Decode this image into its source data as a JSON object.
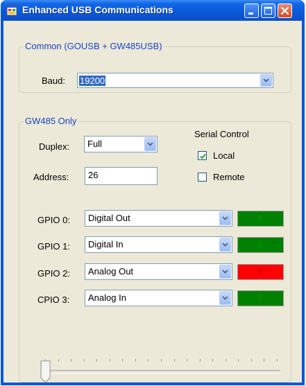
{
  "window": {
    "title": "Enhanced USB Communications",
    "controls": {
      "minimize_icon": "minimize-icon",
      "maximize_icon": "maximize-icon",
      "close_icon": "close-icon"
    }
  },
  "common": {
    "title": "Common (GOUSB + GW485USB)",
    "baud_label": "Baud:",
    "baud_value": "19200"
  },
  "gw485": {
    "title": "GW485 Only",
    "duplex_label": "Duplex:",
    "duplex_value": "Full",
    "address_label": "Address:",
    "address_value": "26",
    "serial_control_label": "Serial Control",
    "local_label": "Local",
    "local_checked": true,
    "remote_label": "Remote",
    "remote_checked": false,
    "gpio": [
      {
        "label": "GPIO 0:",
        "mode": "Digital Out",
        "value": "0",
        "color": "#008000"
      },
      {
        "label": "GPIO 1:",
        "mode": "Digital In",
        "value": "0",
        "color": "#008000"
      },
      {
        "label": "GPIO 2:",
        "mode": "Analog Out",
        "value": "0",
        "color": "#ff0000"
      },
      {
        "label": "CPIO 3:",
        "mode": "Analog In",
        "value": "0",
        "color": "#008000"
      }
    ],
    "slider_value": 0
  }
}
